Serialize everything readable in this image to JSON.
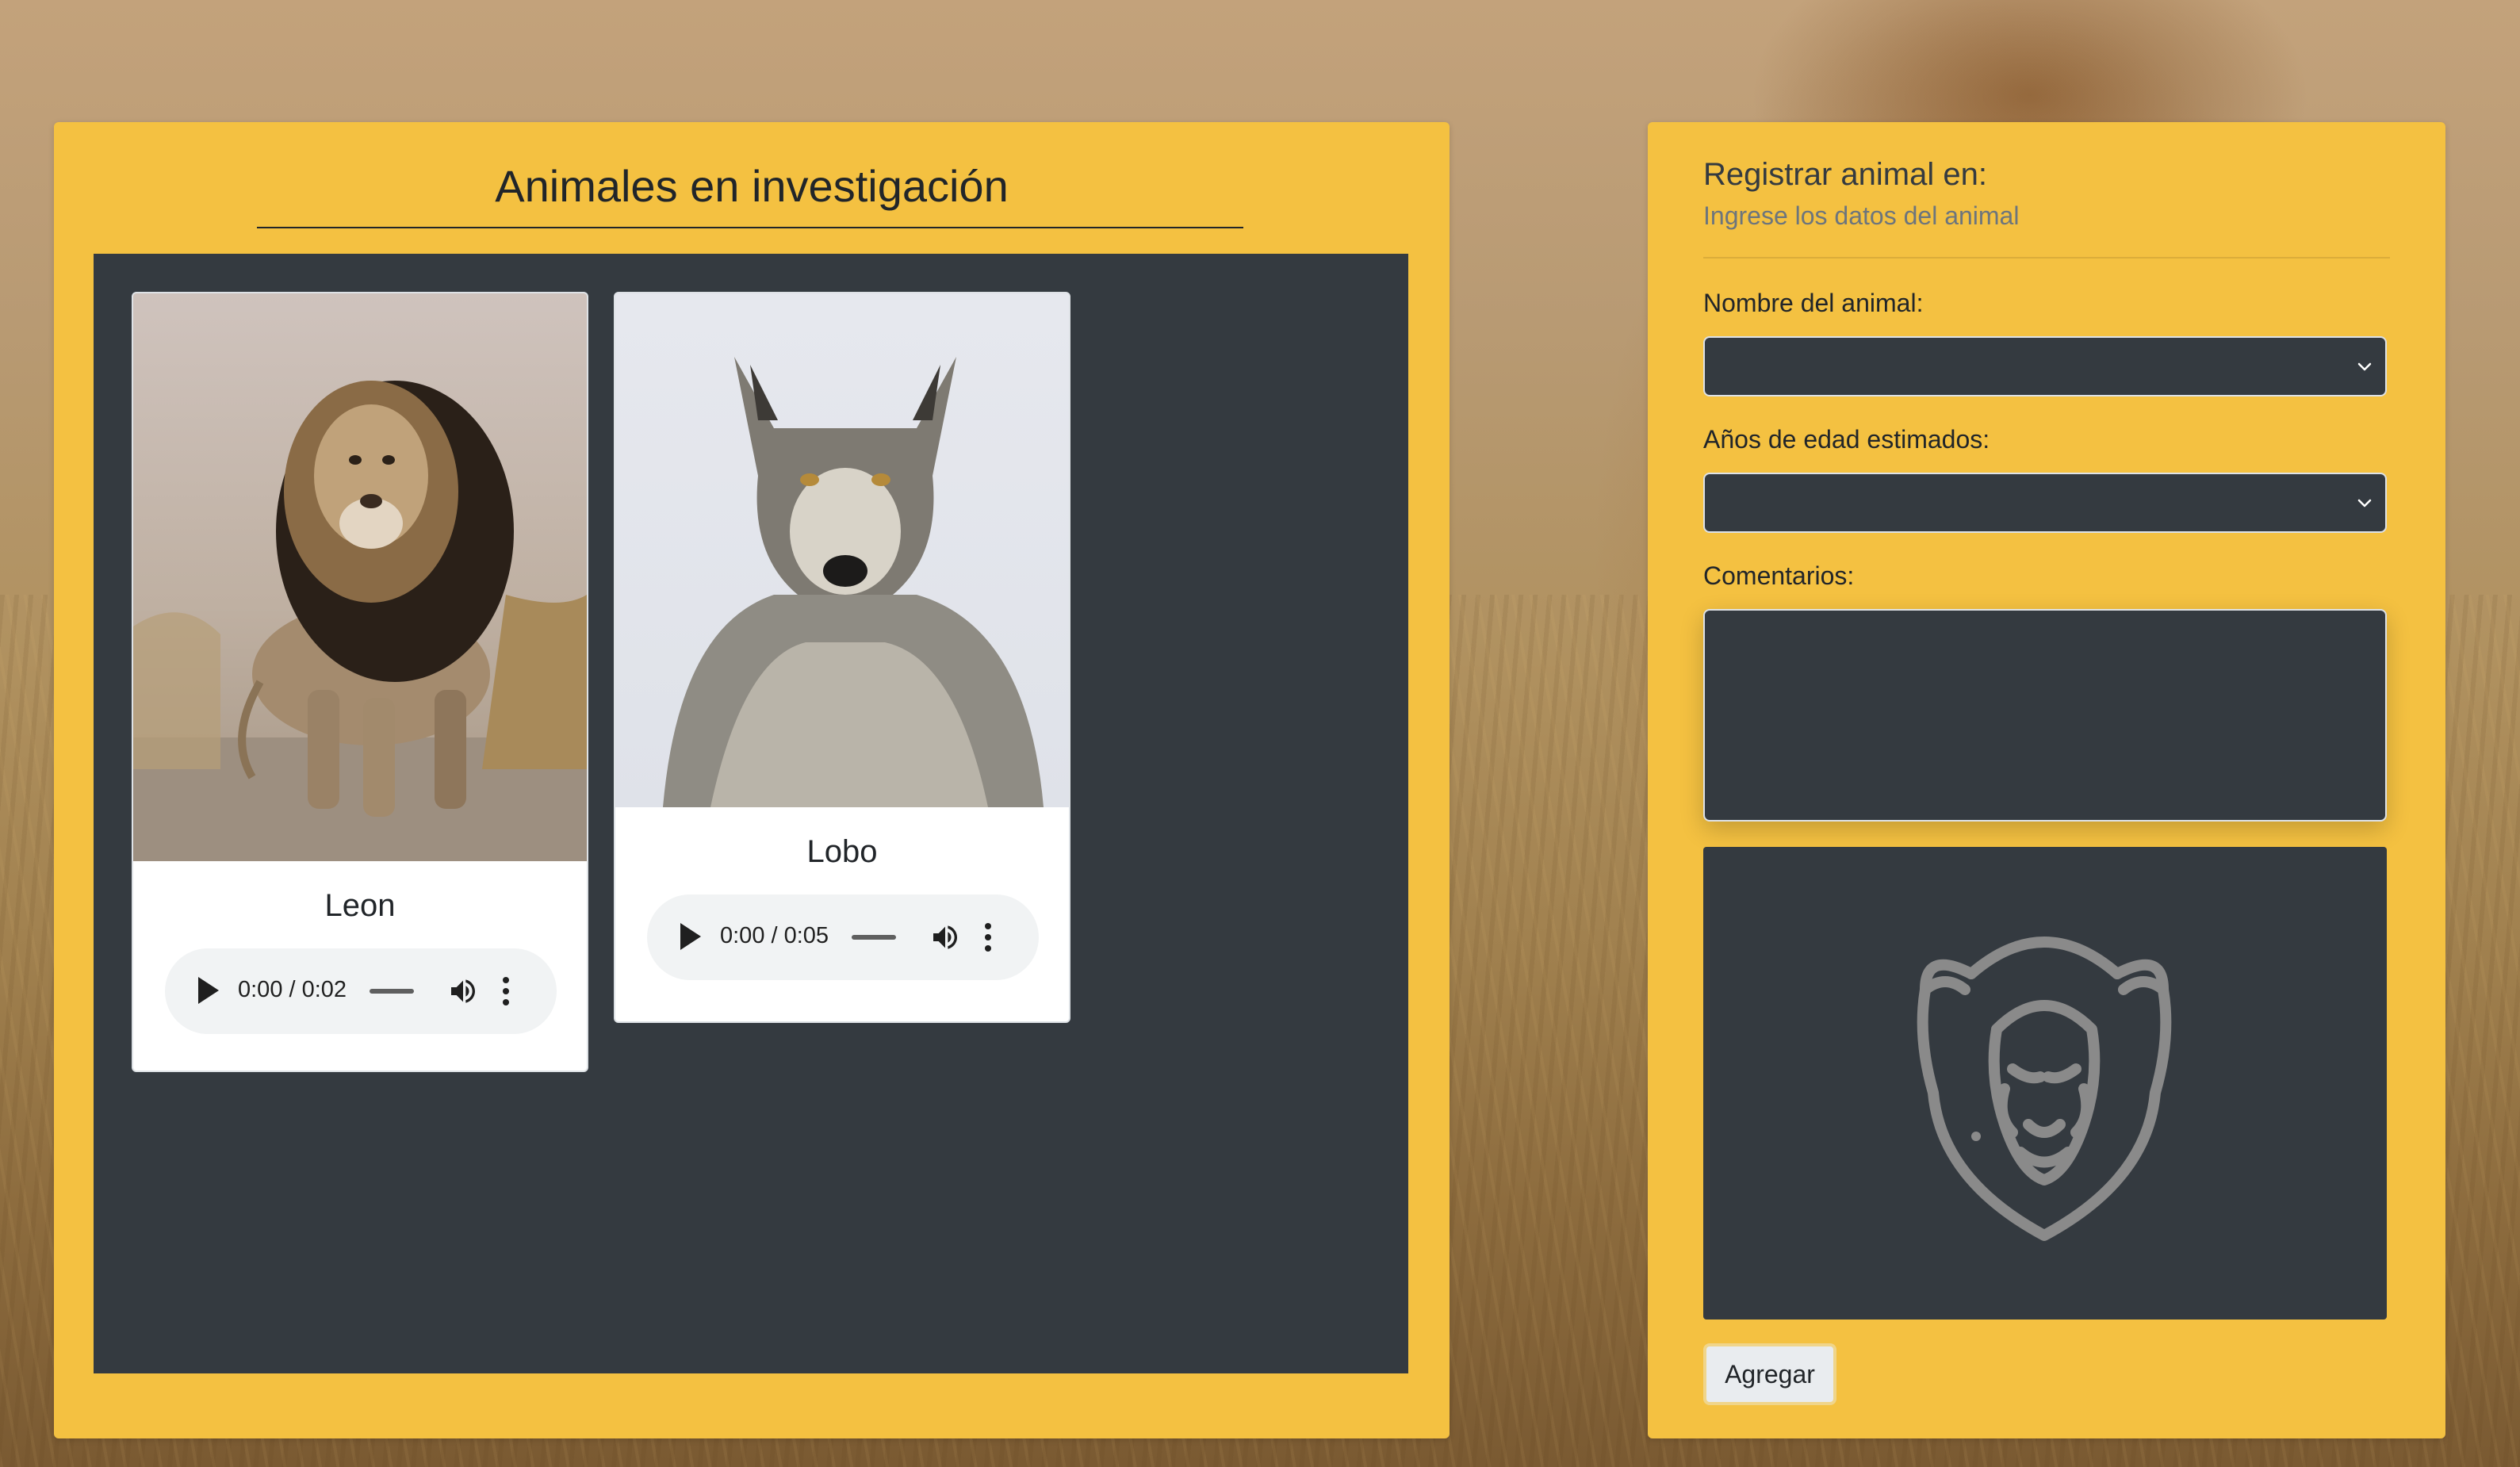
{
  "animals_panel": {
    "title": "Animales en investigación",
    "cards": [
      {
        "name": "Leon",
        "audio_time": "0:00 / 0:02",
        "image_icon": "lion-photo"
      },
      {
        "name": "Lobo",
        "audio_time": "0:00 / 0:05",
        "image_icon": "wolf-photo"
      }
    ]
  },
  "form": {
    "title": "Registrar animal en:",
    "subtitle": "Ingrese los datos del animal",
    "name_label": "Nombre del animal:",
    "name_value": "",
    "age_label": "Años de edad estimados:",
    "age_value": "",
    "comments_label": "Comentarios:",
    "comments_value": "",
    "preview_icon": "lion-outline-icon",
    "submit_label": "Agregar"
  },
  "colors": {
    "panel": "#f4c141",
    "dark": "#343a40",
    "card": "#ffffff"
  }
}
